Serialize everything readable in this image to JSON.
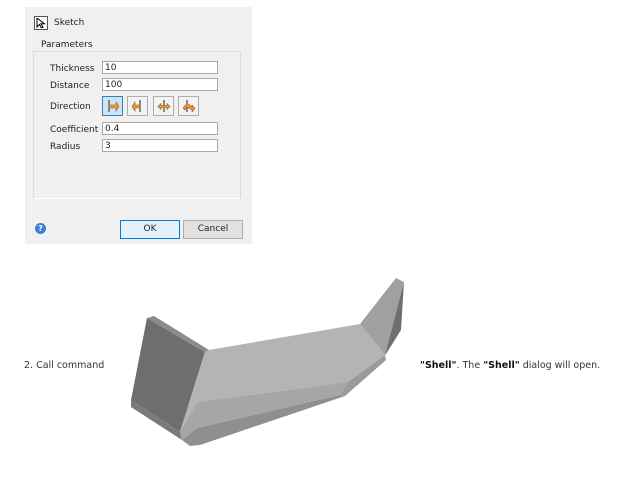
{
  "dialog": {
    "sketch_label": "Sketch",
    "group_title": "Parameters",
    "fields": [
      {
        "label": "Thickness",
        "value": "10"
      },
      {
        "label": "Distance",
        "value": "100"
      },
      {
        "label": "Direction"
      },
      {
        "label": "Coefficient",
        "value": "0.4"
      },
      {
        "label": "Radius",
        "value": "3"
      }
    ],
    "direction_icons": [
      "direction-forward-icon",
      "direction-reverse-icon",
      "direction-both-icon",
      "direction-middle-icon"
    ],
    "help_icon": "?",
    "ok_label": "OK",
    "cancel_label": "Cancel"
  },
  "instruction": {
    "prefix": "2. Call command",
    "command_name": "\"Shell\"",
    "middle": ". The ",
    "dialog_name": "\"Shell\"",
    "suffix": " dialog will open."
  },
  "colors": {
    "dialog_bg": "#f0f0f0",
    "active_button": "#cce4f7",
    "icon_orange": "#d9822b",
    "help_blue": "#3c7fd6"
  }
}
